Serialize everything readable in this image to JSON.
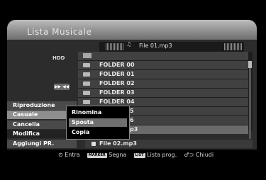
{
  "title": "Lista Musicale",
  "drive_label": "HDD",
  "current_file": "File 01.mp3",
  "icons": {
    "music_note": "♫",
    "play_control": "▶▶ ◀◀"
  },
  "list": {
    "items": [
      {
        "label": ""
      },
      {
        "label": "FOLDER 00"
      },
      {
        "label": "FOLDER 01"
      },
      {
        "label": "FOLDER 02"
      },
      {
        "label": "FOLDER 03"
      },
      {
        "label": "FOLDER 04"
      },
      {
        "label": "5"
      },
      {
        "label": "6"
      },
      {
        "label": "p3"
      }
    ],
    "last_file": "File 02.mp3"
  },
  "left_menu": [
    "Riproduzione",
    "Casuale",
    "Cancella",
    "Modifica",
    "Aggiungi PR."
  ],
  "popup": [
    "Rinomina",
    "Sposta",
    "Copia"
  ],
  "footer": {
    "enter_icon": "⊙",
    "enter": "Entra",
    "marker_key": "MARKER",
    "marker": "Segna",
    "list_key": "LIST",
    "list": "Lista prog.",
    "close_icon": "♂⊃",
    "close": "Chiudi"
  }
}
